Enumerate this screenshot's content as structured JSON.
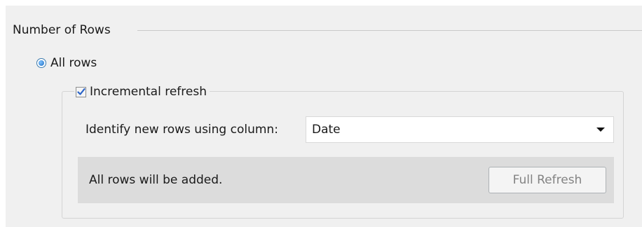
{
  "group": {
    "title": "Number of Rows"
  },
  "all_rows": {
    "label": "All rows",
    "selected": true
  },
  "incremental": {
    "label": "Incremental refresh",
    "checked": true,
    "identify_label": "Identify new rows using column:",
    "column_value": "Date"
  },
  "status": {
    "message": "All rows will be added.",
    "button_label": "Full Refresh",
    "button_enabled": false
  },
  "colors": {
    "panel_bg": "#f0f0f0",
    "status_bg": "#dcdcdc",
    "accent": "#1f6fc1",
    "disabled_text": "#838383"
  },
  "icons": {
    "radio": "radio-selected-icon",
    "checkbox": "checkmark-icon",
    "dropdown": "caret-down-icon"
  }
}
